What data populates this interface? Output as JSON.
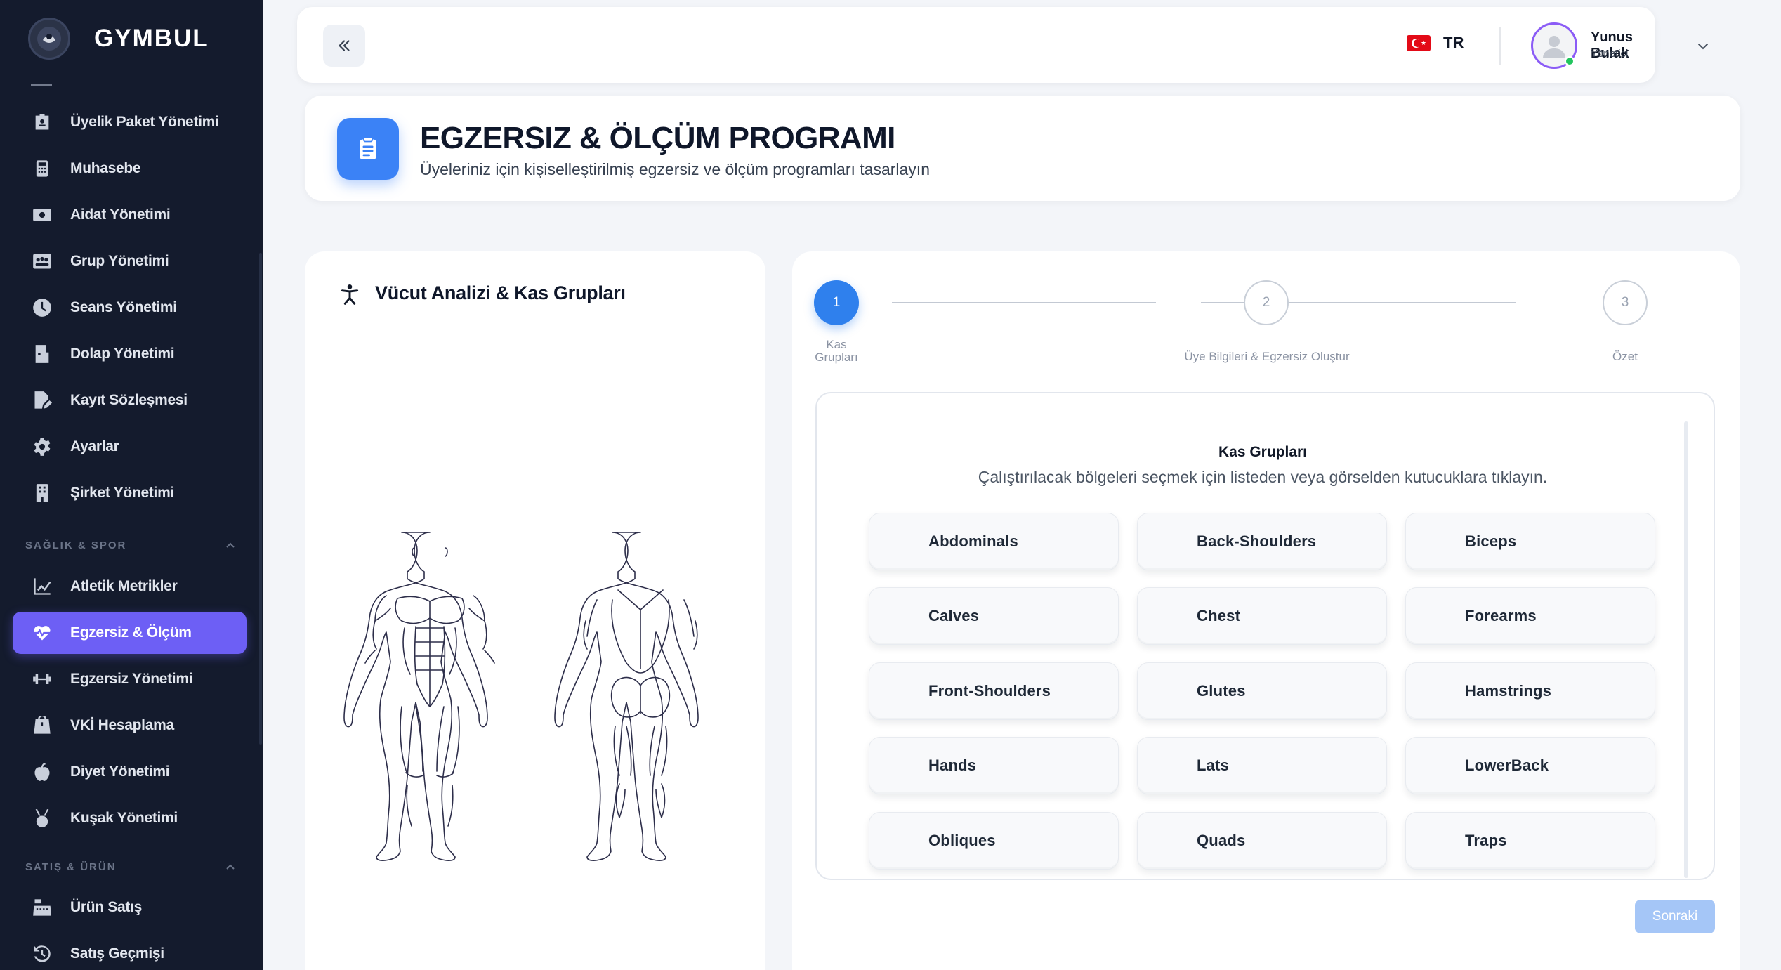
{
  "brand": {
    "name": "GYMBUL"
  },
  "sidebar": {
    "items_top": [
      {
        "label": "Üyelik Paket Yönetimi",
        "icon": "id-card-icon"
      },
      {
        "label": "Muhasebe",
        "icon": "calculator-icon"
      },
      {
        "label": "Aidat Yönetimi",
        "icon": "money-icon"
      },
      {
        "label": "Grup Yönetimi",
        "icon": "group-icon"
      },
      {
        "label": "Seans Yönetimi",
        "icon": "clock-icon"
      },
      {
        "label": "Dolap Yönetimi",
        "icon": "locker-icon"
      },
      {
        "label": "Kayıt Sözleşmesi",
        "icon": "contract-icon"
      },
      {
        "label": "Ayarlar",
        "icon": "gear-icon"
      },
      {
        "label": "Şirket Yönetimi",
        "icon": "building-icon"
      }
    ],
    "section_health": "SAĞLIK & SPOR",
    "items_health": [
      {
        "label": "Atletik Metrikler",
        "icon": "chart-line-icon"
      },
      {
        "label": "Egzersiz & Ölçüm",
        "icon": "heart-pulse-icon",
        "active": true
      },
      {
        "label": "Egzersiz Yönetimi",
        "icon": "dumbbell-icon"
      },
      {
        "label": "VKİ Hesaplama",
        "icon": "weight-icon"
      },
      {
        "label": "Diyet Yönetimi",
        "icon": "apple-icon"
      },
      {
        "label": "Kuşak Yönetimi",
        "icon": "belt-medal-icon"
      }
    ],
    "section_sales": "SATIŞ & ÜRÜN",
    "items_sales": [
      {
        "label": "Ürün Satış",
        "icon": "cash-register-icon"
      },
      {
        "label": "Satış Geçmişi",
        "icon": "history-icon"
      }
    ]
  },
  "topbar": {
    "language_code": "TR",
    "user_name": "Yunus Bulak",
    "user_role": "Yönetici"
  },
  "header": {
    "title": "EGZERSIZ & ÖLÇÜM PROGRAMI",
    "subtitle": "Üyeleriniz için kişiselleştirilmiş egzersiz ve ölçüm programları tasarlayın"
  },
  "body_panel": {
    "title": "Vücut Analizi & Kas Grupları"
  },
  "wizard": {
    "steps": [
      {
        "number": "1",
        "label_line1": "Kas",
        "label_line2": "Grupları",
        "active": true
      },
      {
        "number": "2",
        "label": "Üye Bilgileri & Egzersiz Oluştur"
      },
      {
        "number": "3",
        "label": "Özet"
      }
    ],
    "section_title": "Kas Grupları",
    "section_subtitle": "Çalıştırılacak bölgeleri seçmek için listeden veya görselden kutucuklara tıklayın.",
    "muscles": [
      "Abdominals",
      "Back-Shoulders",
      "Biceps",
      "Calves",
      "Chest",
      "Forearms",
      "Front-Shoulders",
      "Glutes",
      "Hamstrings",
      "Hands",
      "Lats",
      "LowerBack",
      "Obliques",
      "Quads",
      "Traps"
    ],
    "next_label": "Sonraki"
  },
  "colors": {
    "sidebar_bg": "#141b2d",
    "active_nav": "#6d5ff5",
    "accent_blue": "#3b82f6",
    "step_active": "#2f80ed",
    "next_disabled": "#a5c6f7",
    "online": "#22c55e"
  }
}
